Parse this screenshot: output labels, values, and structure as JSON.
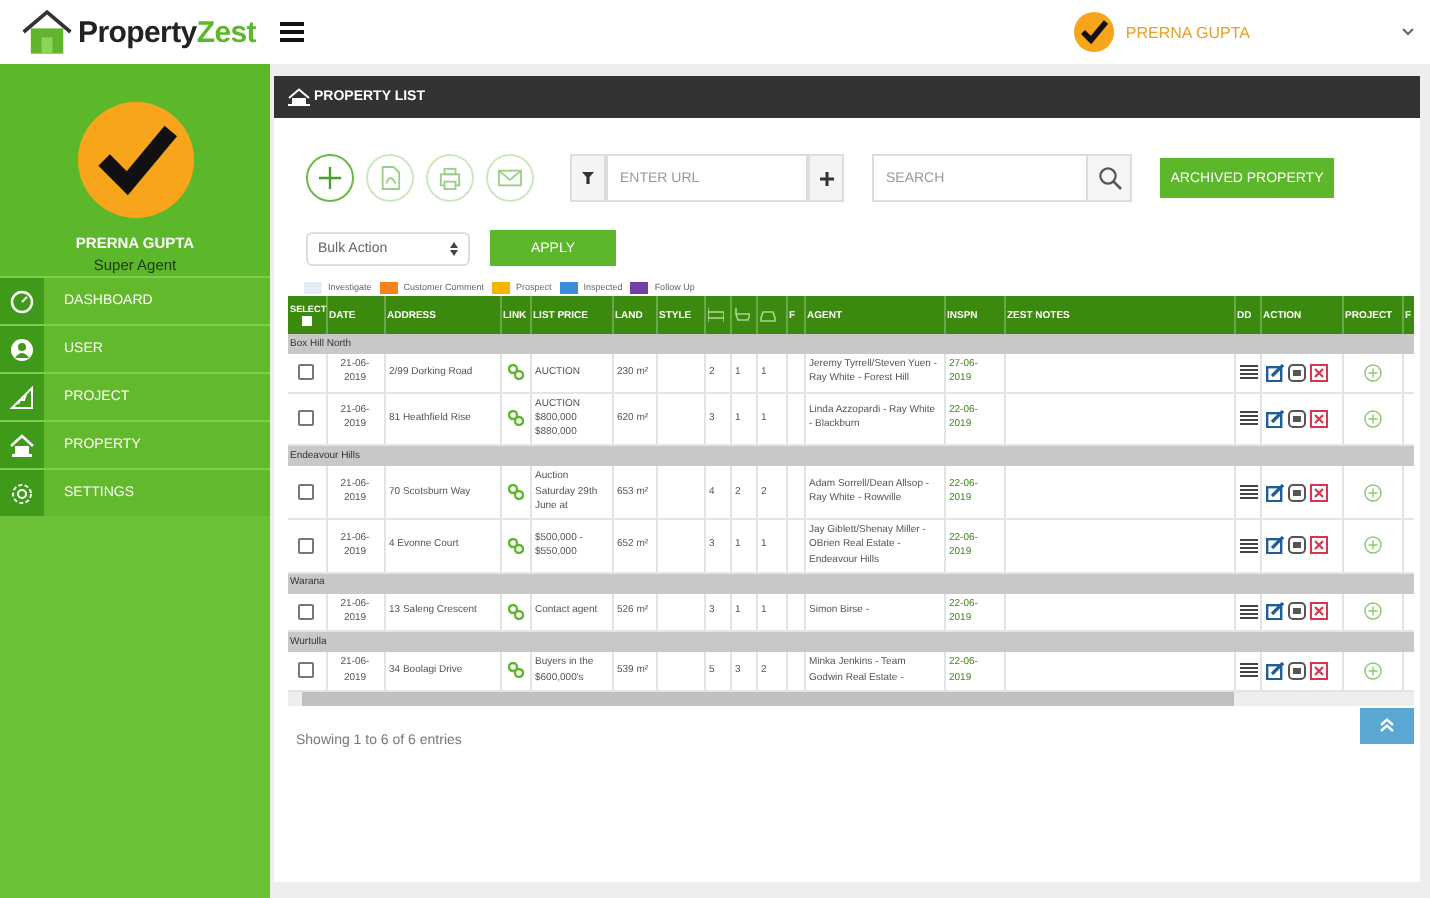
{
  "header": {
    "logo": {
      "text": "Property",
      "accent": "Zest"
    },
    "user_name": "PRERNA GUPTA"
  },
  "sidebar": {
    "profile": {
      "name": "PRERNA GUPTA",
      "role": "Super Agent"
    },
    "items": [
      {
        "label": "DASHBOARD",
        "selected": false
      },
      {
        "label": "USER",
        "selected": false
      },
      {
        "label": "PROJECT",
        "selected": false
      },
      {
        "label": "PROPERTY",
        "selected": false
      },
      {
        "label": "SETTINGS",
        "selected": false
      }
    ]
  },
  "panel": {
    "title": "PROPERTY LIST",
    "url_field": {
      "placeholder": "ENTER URL"
    },
    "search_field": {
      "placeholder": "SEARCH"
    },
    "archived_button": "ARCHIVED PROPERTY",
    "bulk_action": "Bulk Action",
    "apply_button": "APPLY",
    "legend": [
      {
        "label": "Investigate",
        "color": "#e6ecf3"
      },
      {
        "label": "Customer Comment",
        "color": "#f5821f"
      },
      {
        "label": "Prospect",
        "color": "#f7b500"
      },
      {
        "label": "Inspected",
        "color": "#3a8fd8"
      },
      {
        "label": "Follow Up",
        "color": "#7340a8"
      }
    ],
    "table": {
      "select_all_checked": false,
      "columns": [
        {
          "kind": "text",
          "label": "SELECT"
        },
        {
          "kind": "text",
          "label": "DATE"
        },
        {
          "kind": "text",
          "label": "ADDRESS"
        },
        {
          "kind": "text",
          "label": "LINK"
        },
        {
          "kind": "text",
          "label": "LIST PRICE"
        },
        {
          "kind": "text",
          "label": "LAND"
        },
        {
          "kind": "text",
          "label": "STYLE"
        },
        {
          "kind": "icon"
        },
        {
          "kind": "icon"
        },
        {
          "kind": "icon"
        },
        {
          "kind": "text",
          "label": "F"
        },
        {
          "kind": "text",
          "label": "AGENT"
        },
        {
          "kind": "text",
          "label": "INSPN"
        },
        {
          "kind": "text",
          "label": "ZEST NOTES"
        },
        {
          "kind": "text",
          "label": "DD"
        },
        {
          "kind": "text",
          "label": "ACTION"
        },
        {
          "kind": "text",
          "label": "PROJECT"
        },
        {
          "kind": "text",
          "label": "F"
        }
      ],
      "groups": [
        {
          "suburb": "Box Hill North",
          "rows": [
            {
              "checked": false,
              "date": "21-06-2019",
              "address": "2/99 Dorking Road",
              "list_price": "AUCTION",
              "land": "230 m²",
              "bed": "2",
              "bath": "1",
              "car": "1",
              "agent": "Jeremy Tyrrell/Steven Yuen - Ray White - Forest Hill",
              "inspn": "27-06-2019"
            },
            {
              "checked": false,
              "date": "21-06-2019",
              "address": "81 Heathfield Rise",
              "list_price": "AUCTION $800,000 $880,000",
              "land": "620 m²",
              "bed": "3",
              "bath": "1",
              "car": "1",
              "agent": "Linda Azzopardi - Ray White - Blackburn",
              "inspn": "22-06-2019"
            }
          ]
        },
        {
          "suburb": "Endeavour Hills",
          "rows": [
            {
              "checked": false,
              "date": "21-06-2019",
              "address": "70 Scotsburn Way",
              "list_price": "Auction Saturday 29th June at",
              "land": "653 m²",
              "bed": "4",
              "bath": "2",
              "car": "2",
              "agent": "Adam Sorrell/Dean Allsop - Ray White - Rowville",
              "inspn": "22-06-2019"
            },
            {
              "checked": false,
              "date": "21-06-2019",
              "address": "4 Evonne Court",
              "list_price": "$500,000 - $550,000",
              "land": "652 m²",
              "bed": "3",
              "bath": "1",
              "car": "1",
              "agent": "Jay Giblett/Shenay Miller - OBrien Real Estate - Endeavour Hills",
              "inspn": "22-06-2019"
            }
          ]
        },
        {
          "suburb": "Warana",
          "rows": [
            {
              "checked": false,
              "date": "21-06-2019",
              "address": "13 Saleng Crescent",
              "list_price": "Contact agent",
              "land": "526 m²",
              "bed": "3",
              "bath": "1",
              "car": "1",
              "agent": "Simon Birse -",
              "inspn": "22-06-2019"
            }
          ]
        },
        {
          "suburb": "Wurtulla",
          "rows": [
            {
              "checked": false,
              "date": "21-06-2019",
              "address": "34 Boolagi Drive",
              "list_price": "Buyers in the $600,000's",
              "land": "539 m²",
              "bed": "5",
              "bath": "3",
              "car": "2",
              "agent": "Minka Jenkins - Team Godwin Real Estate -",
              "inspn": "22-06-2019"
            }
          ]
        }
      ]
    },
    "entries_info": "Showing 1 to 6 of 6 entries"
  }
}
